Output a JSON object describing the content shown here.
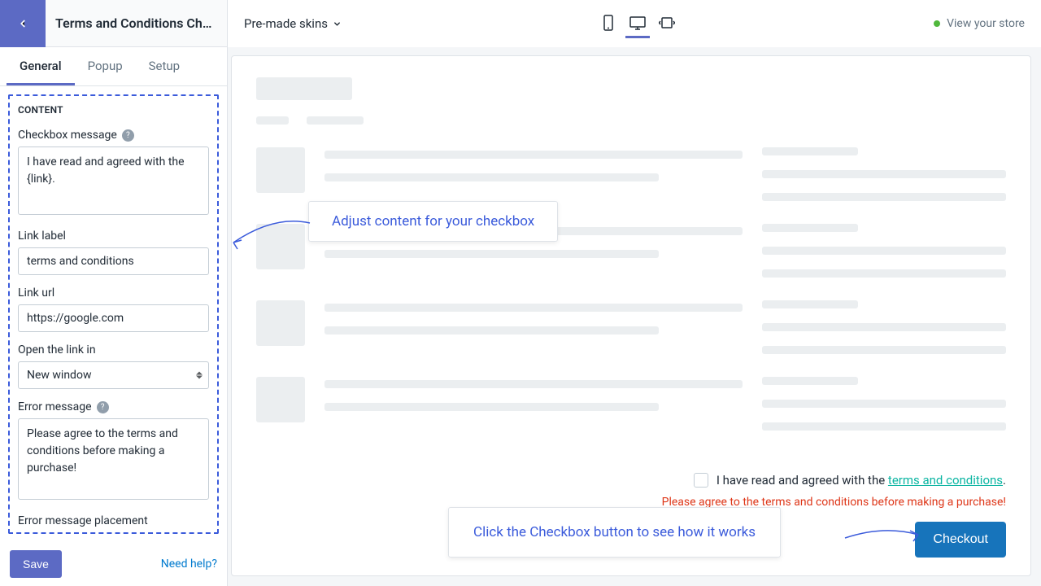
{
  "sidebar": {
    "title": "Terms and Conditions Ch…",
    "tabs": [
      "General",
      "Popup",
      "Setup"
    ],
    "active_tab": 0,
    "section": "CONTENT",
    "checkbox_message": {
      "label": "Checkbox message",
      "value": "I have read and agreed with the {link}."
    },
    "link_label": {
      "label": "Link label",
      "value": "terms and conditions"
    },
    "link_url": {
      "label": "Link url",
      "value": "https://google.com"
    },
    "open_in": {
      "label": "Open the link in",
      "value": "New window"
    },
    "error_message": {
      "label": "Error message",
      "value": "Please agree to the terms and conditions before making a purchase!"
    },
    "error_placement_label": "Error message placement",
    "save": "Save",
    "help": "Need help?"
  },
  "topbar": {
    "skins": "Pre-made skins",
    "view_store": "View your store"
  },
  "preview": {
    "checkbox_text_pre": "I have read and agreed with the ",
    "checkbox_link": "terms and conditions",
    "checkbox_text_post": ".",
    "error": "Please agree to the terms and conditions before making a purchase!",
    "checkout": "Checkout"
  },
  "callouts": {
    "c1": "Adjust content for your checkbox",
    "c2": "Click the Checkbox button to see how it works"
  }
}
